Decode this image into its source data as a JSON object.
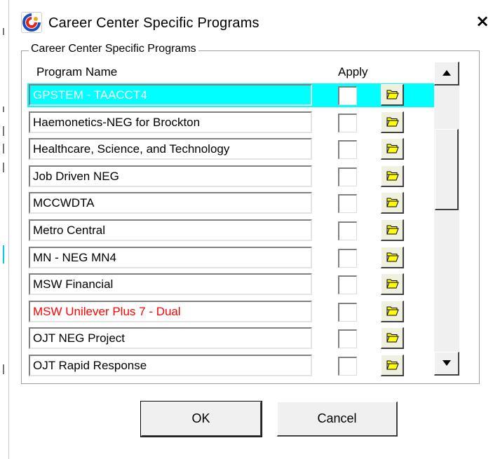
{
  "window": {
    "title": "Career Center Specific Programs",
    "close_label": "×",
    "icon": "app-logo-icon"
  },
  "group": {
    "label": "Career Center Specific Programs"
  },
  "columns": {
    "program_name": "Program Name",
    "apply": "Apply"
  },
  "programs": [
    {
      "name": "GPSTEM - TAACCT4",
      "selected": true,
      "color": "#ffffff",
      "apply": false
    },
    {
      "name": "Haemonetics-NEG for Brockton",
      "selected": false,
      "color": "#000000",
      "apply": false
    },
    {
      "name": "Healthcare, Science, and Technology",
      "selected": false,
      "color": "#000000",
      "apply": false
    },
    {
      "name": "Job Driven NEG",
      "selected": false,
      "color": "#000000",
      "apply": false
    },
    {
      "name": "MCCWDTA",
      "selected": false,
      "color": "#000000",
      "apply": false
    },
    {
      "name": "Metro Central",
      "selected": false,
      "color": "#000000",
      "apply": false
    },
    {
      "name": "MN - NEG MN4",
      "selected": false,
      "color": "#000000",
      "apply": false
    },
    {
      "name": "MSW Financial",
      "selected": false,
      "color": "#000000",
      "apply": false
    },
    {
      "name": "MSW Unilever Plus 7 - Dual",
      "selected": false,
      "color": "#ff0000",
      "apply": false
    },
    {
      "name": "OJT NEG Project",
      "selected": false,
      "color": "#000000",
      "apply": false
    },
    {
      "name": "OJT Rapid Response",
      "selected": false,
      "color": "#000000",
      "apply": false
    }
  ],
  "icons": {
    "folder": "folder-open-icon",
    "scroll_up": "arrow-up-icon",
    "scroll_down": "arrow-down-icon"
  },
  "colors": {
    "selection": "#00ffff",
    "folder_yellow": "#ffff00"
  },
  "buttons": {
    "ok": "OK",
    "cancel": "Cancel"
  }
}
